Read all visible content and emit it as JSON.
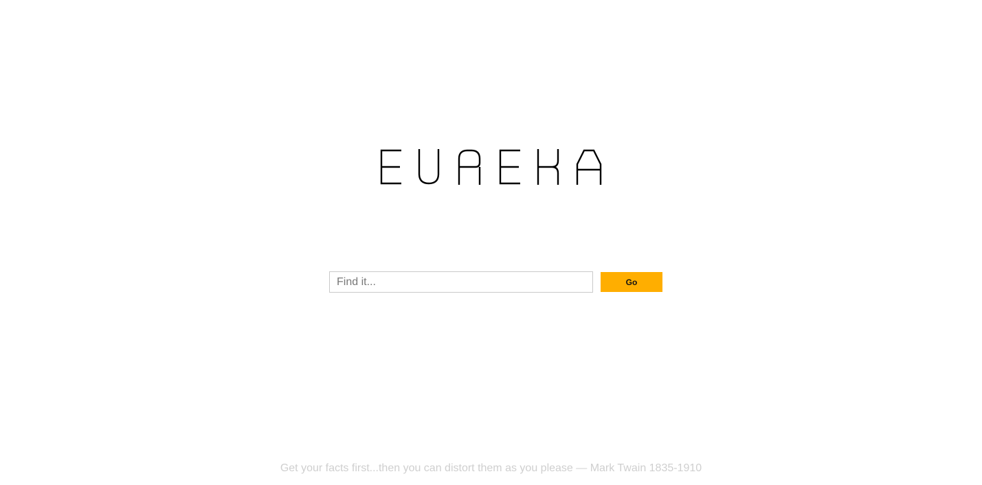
{
  "header": {
    "logo_text": "EUREKA"
  },
  "search": {
    "placeholder": "Find it...",
    "value": "",
    "button_label": "Go"
  },
  "footer": {
    "quote": "Get your facts first...then you can distort them as you please — Mark Twain 1835-1910"
  },
  "colors": {
    "accent": "#ffae00",
    "quote_text": "#cfcfcf",
    "input_border": "#c9c9c9",
    "logo": "#000000"
  }
}
